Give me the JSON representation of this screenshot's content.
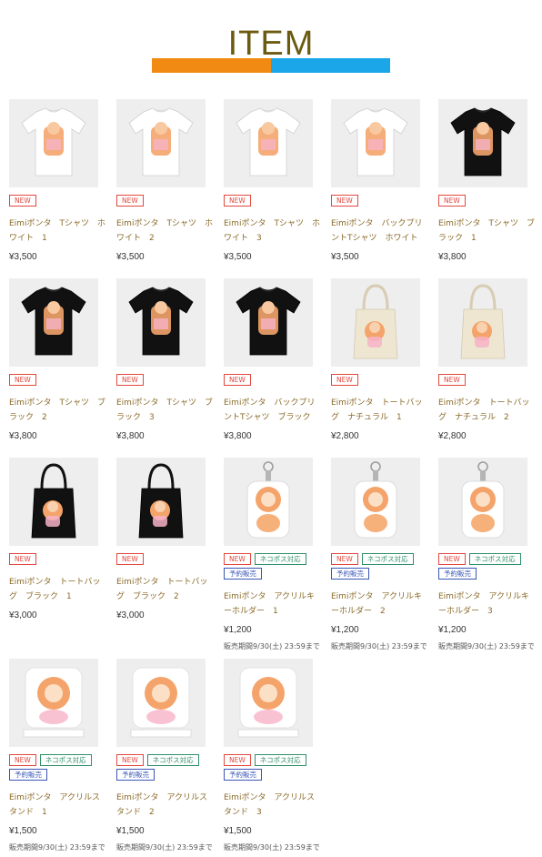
{
  "header": {
    "title": "ITEM",
    "accent_left": "#f08a12",
    "accent_right": "#1aa6e8"
  },
  "labels": {
    "new": "NEW",
    "nekopos": "ネコポス対応",
    "preorder": "予約販売",
    "sale_period": "販売期間9/30(土) 23:59まで"
  },
  "products": [
    {
      "name": "Eimiポンタ　Tシャツ　ホワイト　1",
      "price": "¥3,500",
      "kind": "tshirt",
      "color": "#ffffff",
      "badges": [
        "new"
      ],
      "period": false
    },
    {
      "name": "Eimiポンタ　Tシャツ　ホワイト　2",
      "price": "¥3,500",
      "kind": "tshirt",
      "color": "#ffffff",
      "badges": [
        "new"
      ],
      "period": false
    },
    {
      "name": "Eimiポンタ　Tシャツ　ホワイト　3",
      "price": "¥3,500",
      "kind": "tshirt",
      "color": "#ffffff",
      "badges": [
        "new"
      ],
      "period": false
    },
    {
      "name": "Eimiポンタ　バックプリントTシャツ　ホワイト",
      "price": "¥3,500",
      "kind": "tshirt",
      "color": "#ffffff",
      "badges": [
        "new"
      ],
      "period": false
    },
    {
      "name": "Eimiポンタ　Tシャツ　ブラック　1",
      "price": "¥3,800",
      "kind": "tshirt",
      "color": "#111111",
      "badges": [
        "new"
      ],
      "period": false
    },
    {
      "name": "Eimiポンタ　Tシャツ　ブラック　2",
      "price": "¥3,800",
      "kind": "tshirt",
      "color": "#111111",
      "badges": [
        "new"
      ],
      "period": false
    },
    {
      "name": "Eimiポンタ　Tシャツ　ブラック　3",
      "price": "¥3,800",
      "kind": "tshirt",
      "color": "#111111",
      "badges": [
        "new"
      ],
      "period": false
    },
    {
      "name": "Eimiポンタ　バックプリントTシャツ　ブラック",
      "price": "¥3,800",
      "kind": "tshirt",
      "color": "#111111",
      "badges": [
        "new"
      ],
      "period": false
    },
    {
      "name": "Eimiポンタ　トートバッグ　ナチュラル　1",
      "price": "¥2,800",
      "kind": "tote",
      "color": "#efe6d2",
      "badges": [
        "new"
      ],
      "period": false
    },
    {
      "name": "Eimiポンタ　トートバッグ　ナチュラル　2",
      "price": "¥2,800",
      "kind": "tote",
      "color": "#efe6d2",
      "badges": [
        "new"
      ],
      "period": false
    },
    {
      "name": "Eimiポンタ　トートバッグ　ブラック　1",
      "price": "¥3,000",
      "kind": "tote",
      "color": "#111111",
      "badges": [
        "new"
      ],
      "period": false
    },
    {
      "name": "Eimiポンタ　トートバッグ　ブラック　2",
      "price": "¥3,000",
      "kind": "tote",
      "color": "#111111",
      "badges": [
        "new"
      ],
      "period": false
    },
    {
      "name": "Eimiポンタ　アクリルキーホルダー　1",
      "price": "¥1,200",
      "kind": "keychain",
      "color": "#ffffff",
      "badges": [
        "new",
        "nekopos",
        "preorder"
      ],
      "period": true
    },
    {
      "name": "Eimiポンタ　アクリルキーホルダー　2",
      "price": "¥1,200",
      "kind": "keychain",
      "color": "#ffffff",
      "badges": [
        "new",
        "nekopos",
        "preorder"
      ],
      "period": true
    },
    {
      "name": "Eimiポンタ　アクリルキーホルダー　3",
      "price": "¥1,200",
      "kind": "keychain",
      "color": "#ffffff",
      "badges": [
        "new",
        "nekopos",
        "preorder"
      ],
      "period": true
    },
    {
      "name": "Eimiポンタ　アクリルスタンド　1",
      "price": "¥1,500",
      "kind": "stand",
      "color": "#ffffff",
      "badges": [
        "new",
        "nekopos",
        "preorder"
      ],
      "period": true
    },
    {
      "name": "Eimiポンタ　アクリルスタンド　2",
      "price": "¥1,500",
      "kind": "stand",
      "color": "#ffffff",
      "badges": [
        "new",
        "nekopos",
        "preorder"
      ],
      "period": true
    },
    {
      "name": "Eimiポンタ　アクリルスタンド　3",
      "price": "¥1,500",
      "kind": "stand",
      "color": "#ffffff",
      "badges": [
        "new",
        "nekopos",
        "preorder"
      ],
      "period": true
    }
  ]
}
